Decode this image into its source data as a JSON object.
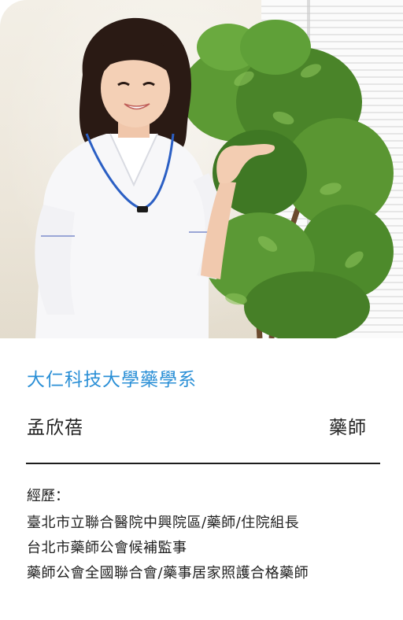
{
  "profile": {
    "school": "大仁科技大學藥學系",
    "name": "孟欣蓓",
    "title": "藥師",
    "experience_label": "經歷：",
    "experience": [
      "臺北市立聯合醫院中興院區/藥師/住院組長",
      "台北市藥師公會候補監事",
      "藥師公會全國聯合會/藥事居家照護合格藥師"
    ]
  },
  "colors": {
    "accent": "#2a8fd6",
    "text": "#222222",
    "divider": "#1c1c1c"
  }
}
